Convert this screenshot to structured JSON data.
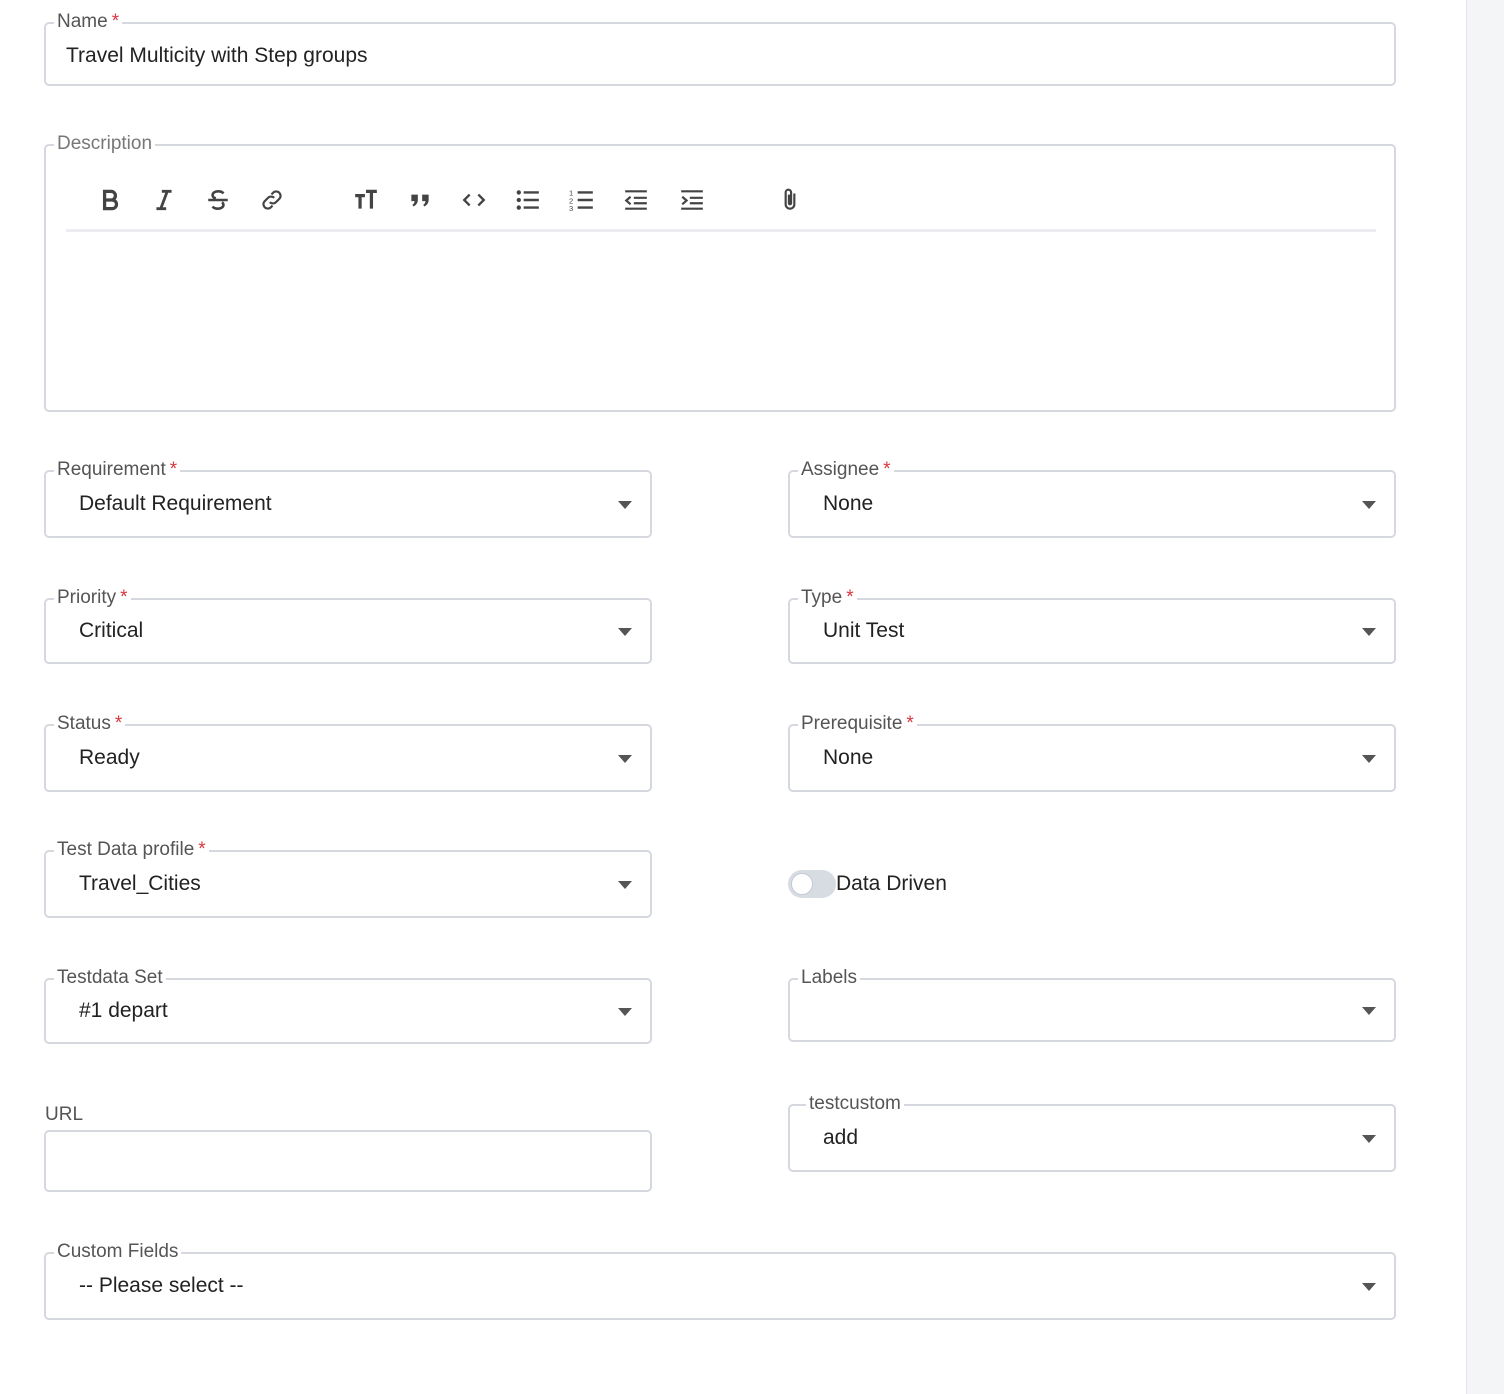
{
  "form": {
    "name": {
      "label": "Name",
      "required": "*",
      "value": "Travel Multicity with Step groups"
    },
    "description": {
      "label": "Description",
      "toolbar": [
        "bold-icon",
        "italic-icon",
        "strikethrough-icon",
        "link-icon",
        "heading-icon",
        "quote-icon",
        "code-icon",
        "bullet-list-icon",
        "numbered-list-icon",
        "outdent-icon",
        "indent-icon",
        "attachment-icon"
      ],
      "value": ""
    },
    "requirement": {
      "label": "Requirement",
      "required": "*",
      "value": "Default Requirement"
    },
    "assignee": {
      "label": "Assignee",
      "required": "*",
      "value": "None"
    },
    "priority": {
      "label": "Priority",
      "required": "*",
      "value": "Critical"
    },
    "type": {
      "label": "Type",
      "required": "*",
      "value": "Unit Test"
    },
    "status": {
      "label": "Status",
      "required": "*",
      "value": "Ready"
    },
    "prerequisite": {
      "label": "Prerequisite",
      "required": "*",
      "value": "None"
    },
    "test_data_profile": {
      "label": "Test Data profile",
      "required": "*",
      "value": "Travel_Cities"
    },
    "data_driven": {
      "label": "Data Driven",
      "enabled": false
    },
    "testdata_set": {
      "label": "Testdata Set",
      "value": "#1 depart"
    },
    "labels": {
      "label": "Labels",
      "value": ""
    },
    "url": {
      "label": "URL",
      "value": ""
    },
    "testcustom": {
      "label": "testcustom",
      "value": "add"
    },
    "custom_fields": {
      "label": "Custom Fields",
      "value": "-- Please select --"
    }
  },
  "colors": {
    "border": "#d5d9df",
    "required": "#d9363e",
    "label": "#555555",
    "text": "#222222"
  }
}
